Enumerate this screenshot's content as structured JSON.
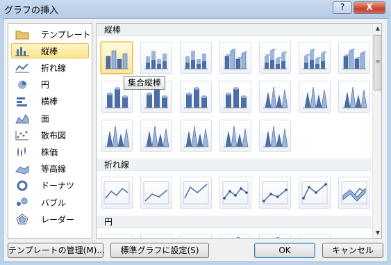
{
  "window": {
    "title": "グラフの挿入",
    "help_icon": "?",
    "close_icon": "X"
  },
  "categories": [
    {
      "label": "テンプレート",
      "icon": "folder-icon",
      "selected": false
    },
    {
      "label": "縦棒",
      "icon": "column-chart-icon",
      "selected": true
    },
    {
      "label": "折れ線",
      "icon": "line-chart-icon",
      "selected": false
    },
    {
      "label": "円",
      "icon": "pie-chart-icon",
      "selected": false
    },
    {
      "label": "横棒",
      "icon": "bar-chart-icon",
      "selected": false
    },
    {
      "label": "面",
      "icon": "area-chart-icon",
      "selected": false
    },
    {
      "label": "散布図",
      "icon": "scatter-chart-icon",
      "selected": false
    },
    {
      "label": "株価",
      "icon": "stock-chart-icon",
      "selected": false
    },
    {
      "label": "等高線",
      "icon": "surface-chart-icon",
      "selected": false
    },
    {
      "label": "ドーナツ",
      "icon": "doughnut-chart-icon",
      "selected": false
    },
    {
      "label": "バブル",
      "icon": "bubble-chart-icon",
      "selected": false
    },
    {
      "label": "レーダー",
      "icon": "radar-chart-icon",
      "selected": false
    }
  ],
  "gallery": {
    "sections": [
      {
        "label": "縦棒",
        "rows": [
          [
            "clustered-column",
            "stacked-column",
            "100-stacked-column",
            "3d-clustered-column",
            "3d-stacked-column",
            "3d-100-stacked-column",
            "3d-column"
          ],
          [
            "clustered-cylinder",
            "stacked-cylinder",
            "100-stacked-cylinder",
            "3d-cylinder",
            "clustered-cone",
            "stacked-cone",
            "100-stacked-cone"
          ],
          [
            "3d-cone",
            "clustered-pyramid",
            "stacked-pyramid",
            "100-stacked-pyramid",
            "3d-pyramid"
          ]
        ]
      },
      {
        "label": "折れ線",
        "rows": [
          [
            "line",
            "stacked-line",
            "100-stacked-line",
            "line-markers",
            "stacked-line-markers",
            "100-stacked-line-markers",
            "3d-line"
          ]
        ]
      },
      {
        "label": "円",
        "rows": [
          [
            "pie",
            "3d-pie",
            "pie-of-pie",
            "exploded-pie",
            "3d-exploded-pie",
            "bar-of-pie"
          ]
        ]
      }
    ],
    "selected": "clustered-column",
    "tooltip": "集合縦棒",
    "scroll": {
      "up_icon": "▲",
      "down_icon": "▼",
      "grip": "≡"
    }
  },
  "buttons": {
    "manage": "テンプレートの管理(M)...",
    "set_default": "標準グラフに設定(S)",
    "ok": "OK",
    "cancel": "キャンセル"
  }
}
